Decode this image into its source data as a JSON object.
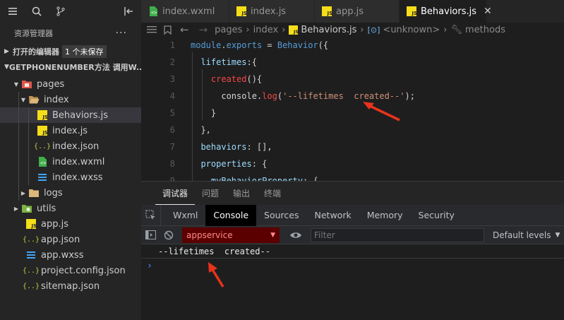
{
  "sidebar": {
    "explorer_title": "资源管理器",
    "more_label": "···",
    "open_editors": {
      "label": "打开的编辑器",
      "badge": "1 个未保存"
    },
    "project": {
      "label": "GETPHONENUMBER方法 调用W..."
    },
    "tree": [
      {
        "label": "pages",
        "icon": "folder-red-icon",
        "expanded": true
      },
      {
        "label": "index",
        "icon": "folder-open-icon",
        "expanded": true
      },
      {
        "label": "Behaviors.js",
        "icon": "js-file-icon",
        "selected": true
      },
      {
        "label": "index.js",
        "icon": "js-file-icon"
      },
      {
        "label": "index.json",
        "icon": "json-file-icon"
      },
      {
        "label": "index.wxml",
        "icon": "wxml-file-icon"
      },
      {
        "label": "index.wxss",
        "icon": "css-file-icon"
      },
      {
        "label": "logs",
        "icon": "folder-icon"
      },
      {
        "label": "utils",
        "icon": "folder-green-icon"
      },
      {
        "label": "app.js",
        "icon": "js-file-icon"
      },
      {
        "label": "app.json",
        "icon": "json-file-icon"
      },
      {
        "label": "app.wxss",
        "icon": "css-file-icon"
      },
      {
        "label": "project.config.json",
        "icon": "json-file-icon"
      },
      {
        "label": "sitemap.json",
        "icon": "json-file-icon"
      }
    ]
  },
  "tabs": [
    {
      "label": "index.wxml",
      "icon": "wxml-file-icon"
    },
    {
      "label": "index.js",
      "icon": "js-file-icon",
      "unsaved": true
    },
    {
      "label": "app.js",
      "icon": "js-file-icon"
    },
    {
      "label": "Behaviors.js",
      "icon": "js-file-icon",
      "active": true
    }
  ],
  "breadcrumbs": [
    "pages",
    "index",
    "Behaviors.js",
    "<unknown>",
    "methods"
  ],
  "code": {
    "line_numbers": [
      "1",
      "2",
      "3",
      "4",
      "5",
      "6",
      "7",
      "8",
      "9"
    ],
    "lines": [
      "module.exports = Behavior({",
      "  lifetimes:{",
      "    created(){",
      "      console.log('--lifetimes  created--');",
      "    }",
      "  },",
      "  behaviors: [],",
      "  properties: {",
      "    myBehaviorProperty: {"
    ]
  },
  "panel": {
    "tabs": [
      "调试器",
      "问题",
      "输出",
      "终端"
    ],
    "active_tab": "调试器",
    "devtools_tabs": [
      "Wxml",
      "Console",
      "Sources",
      "Network",
      "Memory",
      "Security"
    ],
    "active_devtools_tab": "Console",
    "context": "appservice",
    "filter_placeholder": "Filter",
    "levels": "Default levels",
    "log": "--lifetimes  created--",
    "prompt": "›"
  },
  "colors": {
    "annotation_arrow": "#e8331c",
    "context_bg": "#5b0000",
    "accent_js": "#f5de19"
  }
}
